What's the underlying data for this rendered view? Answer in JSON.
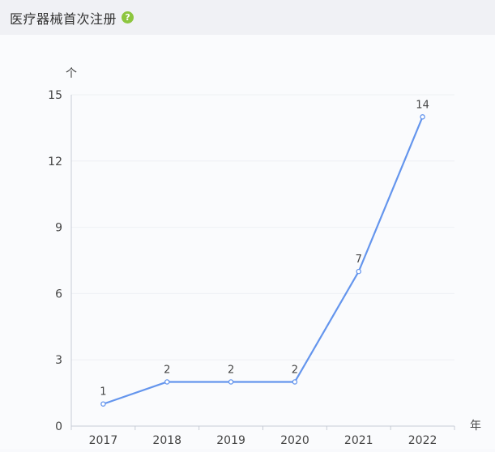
{
  "header": {
    "title": "医疗器械首次注册",
    "help_icon": "question-circle-icon",
    "help_glyph": "?"
  },
  "colors": {
    "line": "#6495ed",
    "grid": "#eef0f4",
    "axis": "#c8cdd6",
    "text": "#444444",
    "help": "#8dc63f"
  },
  "chart_data": {
    "type": "line",
    "categories": [
      "2017",
      "2018",
      "2019",
      "2020",
      "2021",
      "2022"
    ],
    "series": [
      {
        "values": [
          1,
          2,
          2,
          2,
          7,
          14
        ]
      }
    ],
    "y_ticks": [
      0,
      3,
      6,
      9,
      12,
      15
    ],
    "ylim": [
      0,
      15
    ],
    "ylabel": "个",
    "xlabel": "年",
    "data_labels": true,
    "grid": true
  }
}
